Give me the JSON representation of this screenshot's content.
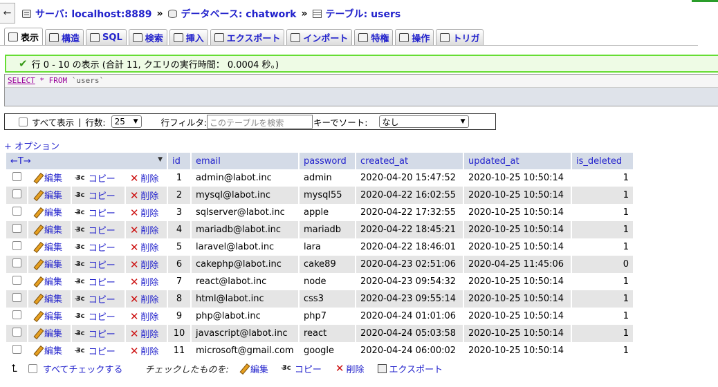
{
  "breadcrumb": {
    "back": "←",
    "server": "サーバ: localhost:8889",
    "database": "データベース: chatwork",
    "table": "テーブル: users",
    "separator": "»"
  },
  "tabs": [
    {
      "label": "表示",
      "icon": "browse-icon"
    },
    {
      "label": "構造",
      "icon": "structure-icon"
    },
    {
      "label": "SQL",
      "icon": "sql-icon"
    },
    {
      "label": "検索",
      "icon": "search-icon"
    },
    {
      "label": "挿入",
      "icon": "insert-icon"
    },
    {
      "label": "エクスポート",
      "icon": "export-icon"
    },
    {
      "label": "インポート",
      "icon": "import-icon"
    },
    {
      "label": "特権",
      "icon": "privileges-icon"
    },
    {
      "label": "操作",
      "icon": "operations-icon"
    },
    {
      "label": "トリガ",
      "icon": "triggers-icon"
    }
  ],
  "success_message": "行 0 - 10 の表示 (合計 11, クエリの実行時間： 0.0004 秒。)",
  "sql": {
    "select": "SELECT",
    "rest": " * FROM ",
    "table": "`users`"
  },
  "navbar": {
    "show_all": "すべて表示",
    "divider": "|",
    "rows_label": "行数:",
    "rows_value": "25",
    "filter_label": "行フィルタ:",
    "filter_placeholder": "このテーブルを検索",
    "sort_label": "キーでソート:",
    "sort_value": "なし"
  },
  "options_link": "+ オプション",
  "table": {
    "sort_control": "←T→",
    "actions": {
      "edit": "編集",
      "copy": "コピー",
      "delete": "削除"
    },
    "columns": [
      "id",
      "email",
      "password",
      "created_at",
      "updated_at",
      "is_deleted"
    ],
    "rows": [
      {
        "id": "1",
        "email": "admin@labot.inc",
        "password": "admin",
        "created_at": "2020-04-20 15:47:52",
        "updated_at": "2020-10-25 10:50:14",
        "is_deleted": "1"
      },
      {
        "id": "2",
        "email": "mysql@labot.inc",
        "password": "mysql55",
        "created_at": "2020-04-22 16:02:55",
        "updated_at": "2020-10-25 10:50:14",
        "is_deleted": "1"
      },
      {
        "id": "3",
        "email": "sqlserver@labot.inc",
        "password": "apple",
        "created_at": "2020-04-22 17:32:55",
        "updated_at": "2020-10-25 10:50:14",
        "is_deleted": "1"
      },
      {
        "id": "4",
        "email": "mariadb@labot.inc",
        "password": "mariadb",
        "created_at": "2020-04-22 18:45:21",
        "updated_at": "2020-10-25 10:50:14",
        "is_deleted": "1"
      },
      {
        "id": "5",
        "email": "laravel@labot.inc",
        "password": "lara",
        "created_at": "2020-04-22 18:46:01",
        "updated_at": "2020-10-25 10:50:14",
        "is_deleted": "1"
      },
      {
        "id": "6",
        "email": "cakephp@labot.inc",
        "password": "cake89",
        "created_at": "2020-04-23 02:51:06",
        "updated_at": "2020-04-25 11:45:06",
        "is_deleted": "0"
      },
      {
        "id": "7",
        "email": "react@labot.inc",
        "password": "node",
        "created_at": "2020-04-23 09:54:32",
        "updated_at": "2020-10-25 10:50:14",
        "is_deleted": "1"
      },
      {
        "id": "8",
        "email": "html@labot.inc",
        "password": "css3",
        "created_at": "2020-04-23 09:55:14",
        "updated_at": "2020-10-25 10:50:14",
        "is_deleted": "1"
      },
      {
        "id": "9",
        "email": "php@labot.inc",
        "password": "php7",
        "created_at": "2020-04-24 01:01:06",
        "updated_at": "2020-10-25 10:50:14",
        "is_deleted": "1"
      },
      {
        "id": "10",
        "email": "javascript@labot.inc",
        "password": "react",
        "created_at": "2020-04-24 05:03:58",
        "updated_at": "2020-10-25 10:50:14",
        "is_deleted": "1"
      },
      {
        "id": "11",
        "email": "microsoft@gmail.com",
        "password": "google",
        "created_at": "2020-04-24 06:00:02",
        "updated_at": "2020-10-25 10:50:14",
        "is_deleted": "1"
      }
    ]
  },
  "footer": {
    "check_all": "すべてチェックする",
    "with_selected": "チェックしたものを:",
    "edit": "編集",
    "copy": "コピー",
    "delete": "削除",
    "export": "エクスポート"
  },
  "colors": {
    "link": "#2222cc",
    "success_border": "#66dd33",
    "header_bg": "#d4dbe7",
    "stripe": "#e5e5e5"
  }
}
